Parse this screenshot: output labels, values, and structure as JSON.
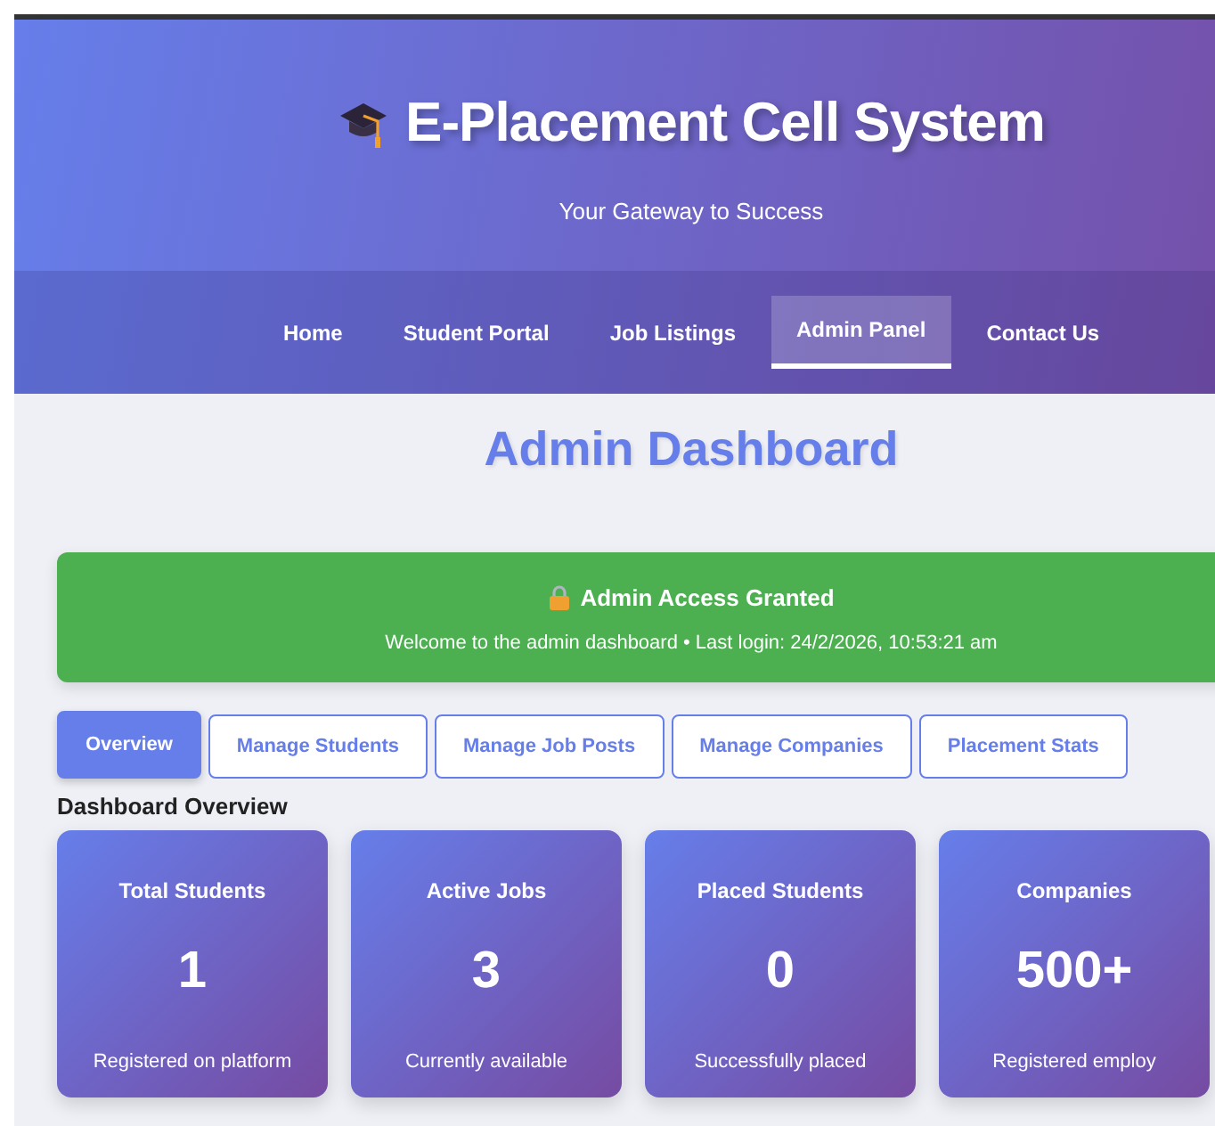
{
  "header": {
    "title": "E-Placement Cell System",
    "subtitle": "Your Gateway to Success"
  },
  "nav": [
    {
      "label": "Home",
      "selected": false
    },
    {
      "label": "Student Portal",
      "selected": false
    },
    {
      "label": "Job Listings",
      "selected": false
    },
    {
      "label": "Admin Panel",
      "selected": true
    },
    {
      "label": "Contact Us",
      "selected": false
    }
  ],
  "page_title": "Admin Dashboard",
  "banner": {
    "title": "Admin Access Granted",
    "message": "Welcome to the admin dashboard • Last login: 24/2/2026, 10:53:21 am"
  },
  "tabs": [
    {
      "label": "Overview",
      "selected": true
    },
    {
      "label": "Manage Students",
      "selected": false
    },
    {
      "label": "Manage Job Posts",
      "selected": false
    },
    {
      "label": "Manage Companies",
      "selected": false
    },
    {
      "label": "Placement Stats",
      "selected": false
    }
  ],
  "section_title": "Dashboard Overview",
  "stats": [
    {
      "label": "Total Students",
      "value": "1",
      "description": "Registered on platform"
    },
    {
      "label": "Active Jobs",
      "value": "3",
      "description": "Currently available"
    },
    {
      "label": "Placed Students",
      "value": "0",
      "description": "Successfully placed"
    },
    {
      "label": "Companies",
      "value": "500+",
      "description": "Registered employ"
    }
  ]
}
